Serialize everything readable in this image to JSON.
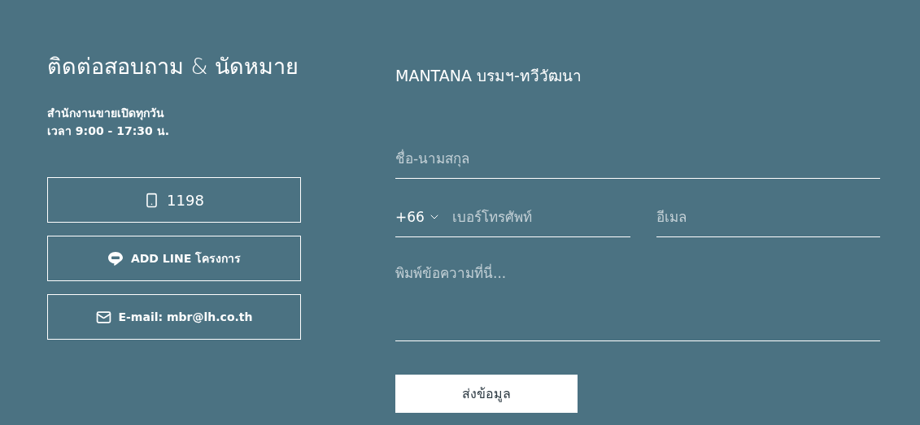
{
  "contact": {
    "title": "ติดต่อสอบถาม & นัดหมาย",
    "hours": [
      "สำนักงานขายเปิดทุกวัน",
      "เวลา 9:00 - 17:30 น."
    ],
    "buttons": [
      {
        "kind": "phone",
        "label": "1198"
      },
      {
        "kind": "line",
        "label": "ADD LINE โครงการ"
      },
      {
        "kind": "email",
        "label": "E-mail: mbr@lh.co.th"
      }
    ]
  },
  "form": {
    "project": "MANTANA บรมฯ-ทวีวัฒนา",
    "name": {
      "placeholder": "ชื่อ-นามสกุล"
    },
    "country_code": "+66",
    "phone": {
      "placeholder": "เบอร์โทรศัพท์"
    },
    "email": {
      "placeholder": "อีเมล"
    },
    "message": {
      "placeholder": "พิมพ์ข้อความที่นี่..."
    },
    "submit": "ส่งข้อมูล"
  }
}
